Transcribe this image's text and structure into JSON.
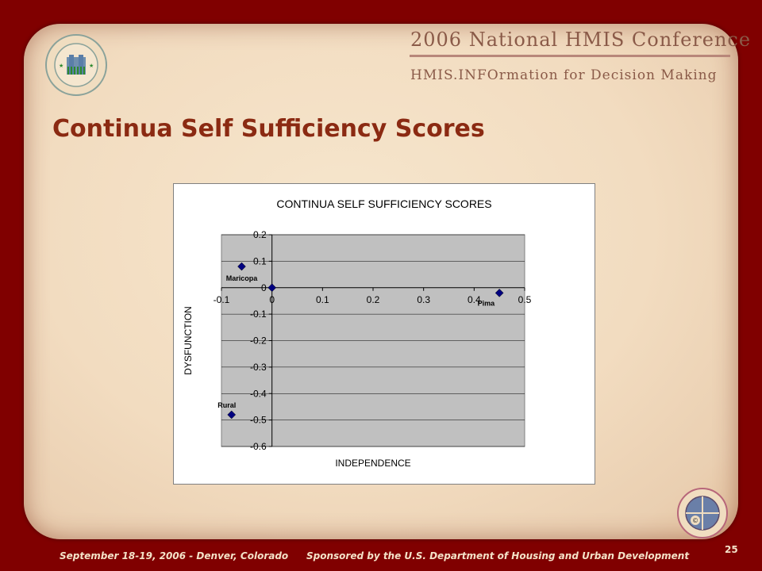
{
  "header": {
    "conference_title": "2006 National HMIS Conference",
    "conference_subtitle": "HMIS.INFOrmation for Decision Making"
  },
  "slide": {
    "title": "Continua Self Sufficiency Scores",
    "page_number": "25"
  },
  "footer": {
    "event": "September 18-19, 2006 - Denver, Colorado",
    "sponsor": "Sponsored by the U.S. Department of Housing and Urban Development"
  },
  "logos": {
    "hud_seal": "U.S. DEPARTMENT OF HOUSING AND URBAN DEVELOPMENT",
    "conference_seal": "National HMIS Conference"
  },
  "colors": {
    "frame": "#800000",
    "title": "#8b2a12",
    "plot_area": "#c0c0c0",
    "marker": "#000080"
  },
  "chart_data": {
    "type": "scatter",
    "title": "CONTINUA SELF SUFFICIENCY SCORES",
    "xlabel": "INDEPENDENCE",
    "ylabel": "DYSFUNCTION",
    "xlim": [
      -0.1,
      0.5
    ],
    "ylim": [
      -0.6,
      0.2
    ],
    "x_ticks": [
      "-0.1",
      "0",
      "0.1",
      "0.2",
      "0.3",
      "0.4",
      "0.5"
    ],
    "y_ticks": [
      "0.2",
      "0.1",
      "0",
      "-0.1",
      "-0.2",
      "-0.3",
      "-0.4",
      "-0.5",
      "-0.6"
    ],
    "grid": true,
    "points": [
      {
        "label": "Maricopa",
        "x": -0.06,
        "y": 0.08
      },
      {
        "label": "",
        "x": 0.0,
        "y": 0.0
      },
      {
        "label": "Pima",
        "x": 0.45,
        "y": -0.02
      },
      {
        "label": "Rural",
        "x": -0.08,
        "y": -0.48
      }
    ]
  }
}
